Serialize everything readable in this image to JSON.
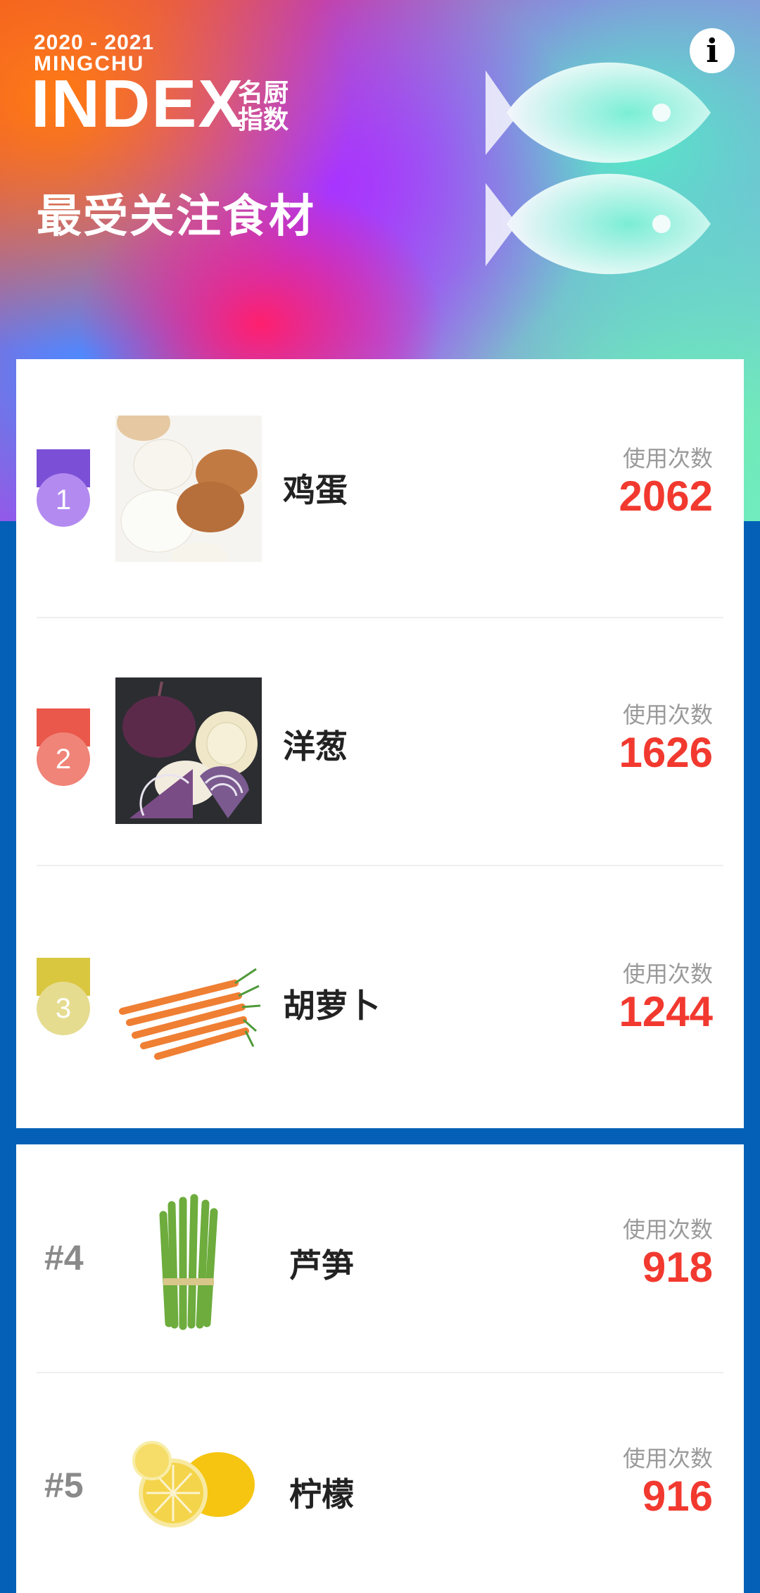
{
  "header": {
    "year": "2020 - 2021",
    "brand_sub": "MINGCHU",
    "brand_index": "INDEX",
    "brand_cn_line1": "名厨",
    "brand_cn_line2": "指数",
    "title": "最受关注食材",
    "info_icon": "info-icon",
    "info_label": "i"
  },
  "top_three": [
    {
      "rank": "1",
      "name": "鸡蛋",
      "usage_label": "使用次数",
      "usage_count": "2062",
      "medal_color": "#7b4fd6",
      "disc_color": "#b38bf0",
      "image_icon": "eggs-image"
    },
    {
      "rank": "2",
      "name": "洋葱",
      "usage_label": "使用次数",
      "usage_count": "1626",
      "medal_color": "#e9584a",
      "disc_color": "#f08478",
      "image_icon": "onion-image"
    },
    {
      "rank": "3",
      "name": "胡萝卜",
      "usage_label": "使用次数",
      "usage_count": "1244",
      "medal_color": "#d9c740",
      "disc_color": "#e6dc90",
      "image_icon": "carrot-image"
    }
  ],
  "others": [
    {
      "rank": "#4",
      "name": "芦笋",
      "usage_label": "使用次数",
      "usage_count": "918",
      "image_icon": "asparagus-image"
    },
    {
      "rank": "#5",
      "name": "柠檬",
      "usage_label": "使用次数",
      "usage_count": "916",
      "image_icon": "lemon-image"
    }
  ],
  "colors": {
    "background_blue": "#0460b6",
    "usage_value": "#f2392f",
    "usage_label": "#9a9a9a"
  }
}
